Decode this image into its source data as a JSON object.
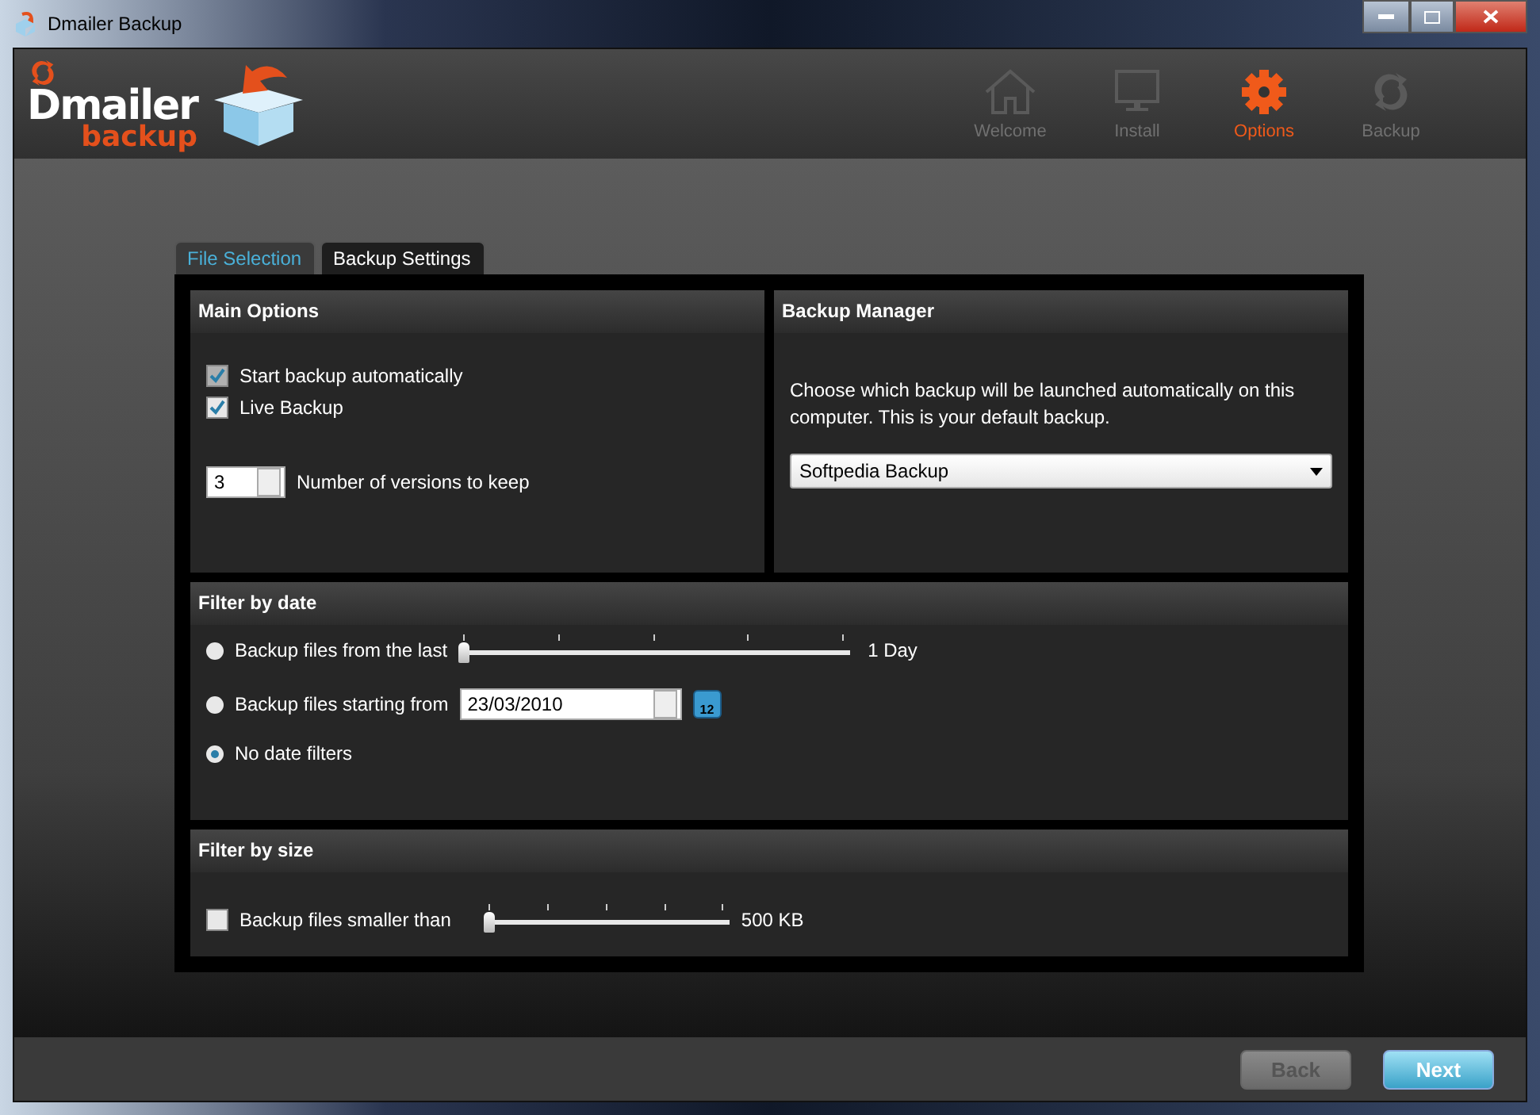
{
  "window": {
    "title": "Dmailer Backup"
  },
  "logo": {
    "name": "Dmailer",
    "sub": "backup"
  },
  "nav": [
    {
      "label": "Welcome",
      "kind": "home",
      "selected": false
    },
    {
      "label": "Install",
      "kind": "monitor",
      "selected": false
    },
    {
      "label": "Options",
      "kind": "gear",
      "selected": true
    },
    {
      "label": "Backup",
      "kind": "sync",
      "selected": false
    }
  ],
  "tabs": [
    {
      "label": "File Selection",
      "selected": false
    },
    {
      "label": "Backup Settings",
      "selected": true
    }
  ],
  "main_options": {
    "title": "Main Options",
    "checkboxes": [
      {
        "label": "Start backup automatically",
        "checked": true,
        "disabled": true
      },
      {
        "label": "Live Backup",
        "checked": true,
        "disabled": false
      }
    ],
    "versions": {
      "value": "3",
      "label": "Number of versions to keep"
    }
  },
  "backup_manager": {
    "title": "Backup Manager",
    "description": "Choose which backup will be launched automatically on this computer. This is your default backup.",
    "selected_backup": "Softpedia Backup"
  },
  "filter_by_date": {
    "title": "Filter by date",
    "options": [
      {
        "kind": "slider",
        "label": "Backup files from the last",
        "selected": false,
        "level": 0,
        "reading": "1 Day"
      },
      {
        "kind": "date",
        "label": "Backup files starting from",
        "selected": false,
        "value": "23/03/2010",
        "calendar_day": "12"
      },
      {
        "kind": "plain",
        "label": "No date filters",
        "selected": true
      }
    ]
  },
  "filter_by_size": {
    "title": "Filter by size",
    "label": "Backup files smaller than",
    "checked": false,
    "level": 0,
    "reading": "500 KB"
  },
  "buttons": [
    {
      "label": "Back",
      "disabled": true
    },
    {
      "label": "Next",
      "disabled": false
    }
  ]
}
